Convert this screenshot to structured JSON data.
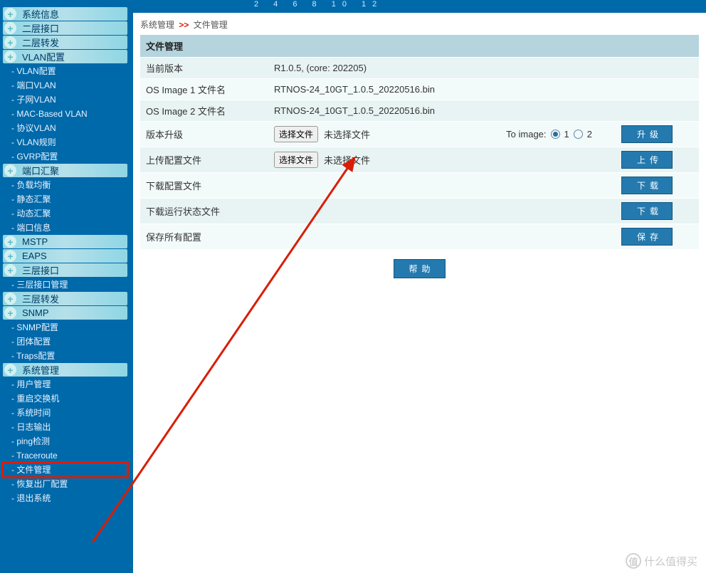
{
  "ruler": "2  4  6  8  10  12",
  "breadcrumb": {
    "parent": "系统管理",
    "sep": ">>",
    "current": "文件管理"
  },
  "panel": {
    "title": "文件管理",
    "current_version_label": "当前版本",
    "current_version_value": "R1.0.5, (core: 202205)",
    "os1_label": "OS Image 1 文件名",
    "os1_value": "RTNOS-24_10GT_1.0.5_20220516.bin",
    "os2_label": "OS Image 2 文件名",
    "os2_value": "RTNOS-24_10GT_1.0.5_20220516.bin",
    "upgrade_label": "版本升级",
    "upload_label": "上传配置文件",
    "dl_cfg_label": "下载配置文件",
    "dl_run_label": "下载运行状态文件",
    "save_label": "保存所有配置",
    "choose_file": "选择文件",
    "no_file": "未选择文件",
    "to_image": "To image:",
    "opt1": "1",
    "opt2": "2",
    "btn_upgrade": "升级",
    "btn_upload": "上传",
    "btn_download": "下载",
    "btn_save": "保存",
    "btn_help": "帮助"
  },
  "sidebar": {
    "headers": {
      "sysinfo": "系统信息",
      "l2if": "二层接口",
      "l2fw": "二层转发",
      "vlan": "VLAN配置",
      "link": "端口汇聚",
      "mstp": "MSTP",
      "eaps": "EAPS",
      "l3if": "三层接口",
      "l3fw": "三层转发",
      "snmp": "SNMP",
      "sysmgmt": "系统管理"
    },
    "vlan_items": [
      "- VLAN配置",
      "- 端口VLAN",
      "- 子网VLAN",
      "- MAC-Based VLAN",
      "- 协议VLAN",
      "- VLAN规则",
      "- GVRP配置"
    ],
    "link_items": [
      "- 负载均衡",
      "- 静态汇聚",
      "- 动态汇聚",
      "- 端口信息"
    ],
    "l3if_items": [
      "- 三层接口管理"
    ],
    "snmp_items": [
      "- SNMP配置",
      "- 团体配置",
      "- Traps配置"
    ],
    "sysmgmt_items": [
      "- 用户管理",
      "- 重启交换机",
      "- 系统时间",
      "- 日志输出",
      "- ping检测",
      "- Traceroute",
      "- 文件管理",
      "- 恢复出厂配置",
      "- 退出系统"
    ]
  },
  "watermark": "什么值得买"
}
